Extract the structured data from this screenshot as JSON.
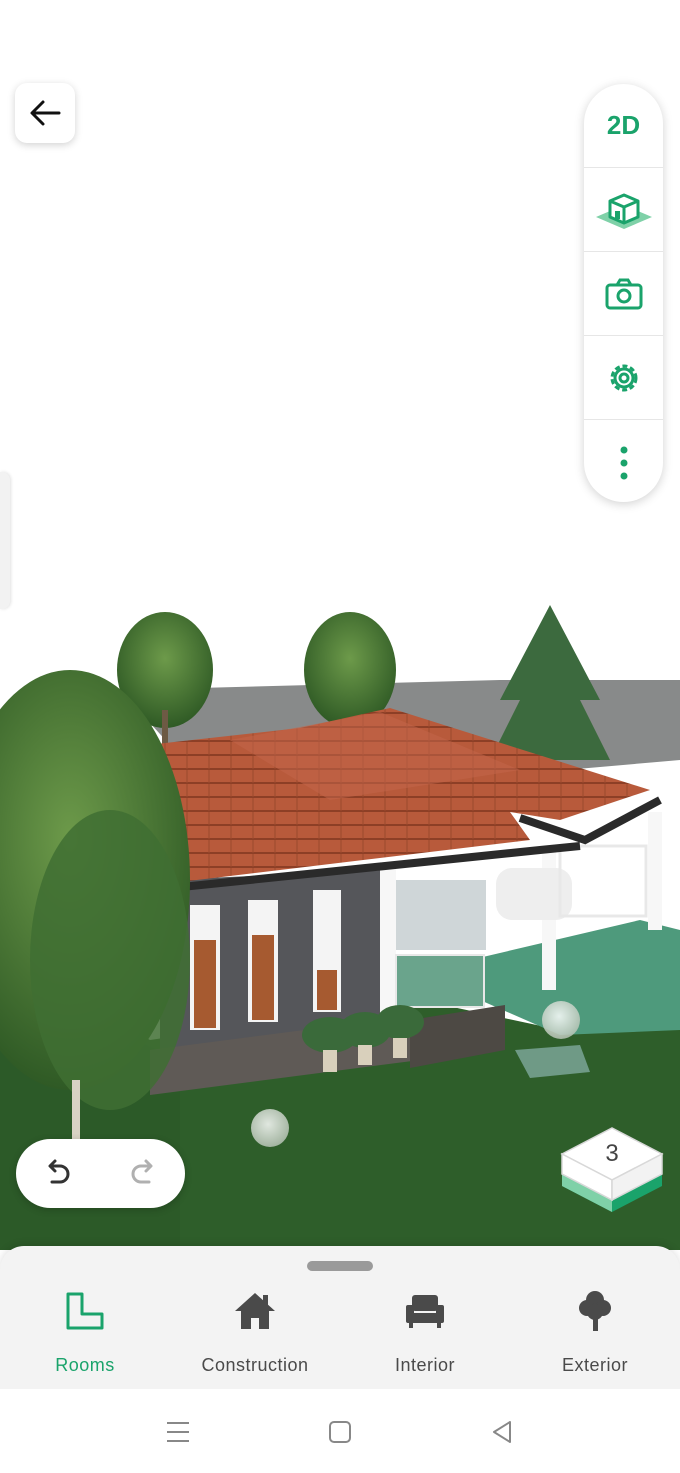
{
  "toolbar": {
    "view_2d_label": "2D",
    "icons": [
      "3d-view-icon",
      "camera-icon",
      "settings-icon",
      "more-icon"
    ]
  },
  "floor": {
    "level": "3"
  },
  "bottom_nav": {
    "tabs": [
      {
        "label": "Rooms",
        "icon": "rooms-icon",
        "active": true
      },
      {
        "label": "Construction",
        "icon": "house-icon",
        "active": false
      },
      {
        "label": "Interior",
        "icon": "sofa-icon",
        "active": false
      },
      {
        "label": "Exterior",
        "icon": "tree-icon",
        "active": false
      }
    ]
  },
  "colors": {
    "accent": "#1aa36b",
    "roof": "#b5573a",
    "grass": "#2e5e2a",
    "wall": "#55565a"
  }
}
